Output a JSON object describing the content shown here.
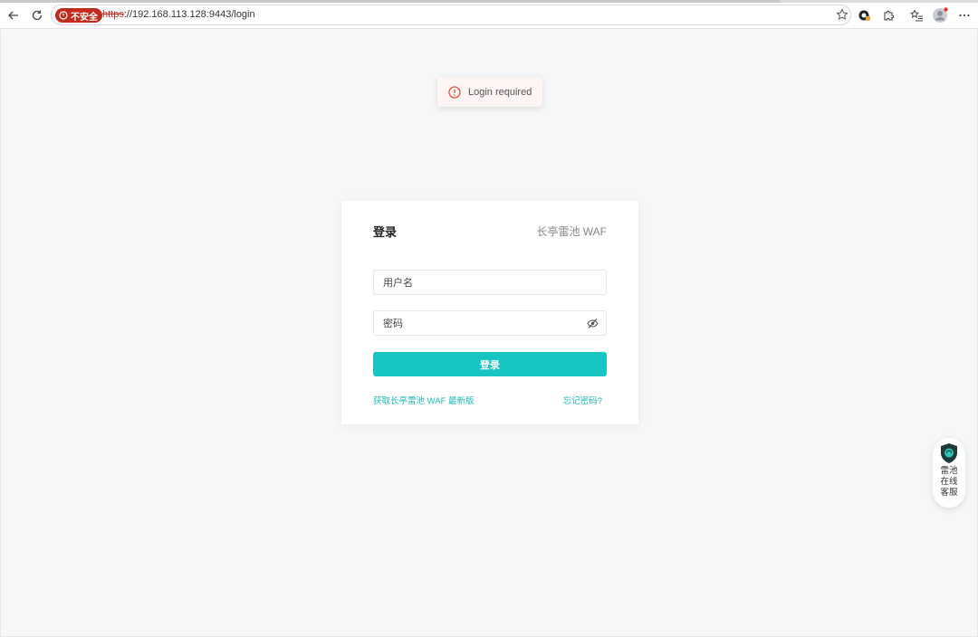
{
  "browser": {
    "security_label": "不安全",
    "url_scheme": "https",
    "url_rest": "://192.168.113.128:9443/login"
  },
  "toast": {
    "message": "Login required"
  },
  "login_card": {
    "title": "登录",
    "brand": "长亭雷池 WAF",
    "username_placeholder": "用户名",
    "password_placeholder": "密码",
    "submit_label": "登录",
    "get_latest_link": "获取长亭雷池 WAF 最新版",
    "forgot_password_link": "忘记密码?"
  },
  "support_widget": {
    "lines": [
      "雷池",
      "在线",
      "客服"
    ]
  },
  "colors": {
    "accent": "#16c5c2",
    "insecure": "#c42b1c",
    "toast_icon": "#e5533d"
  }
}
